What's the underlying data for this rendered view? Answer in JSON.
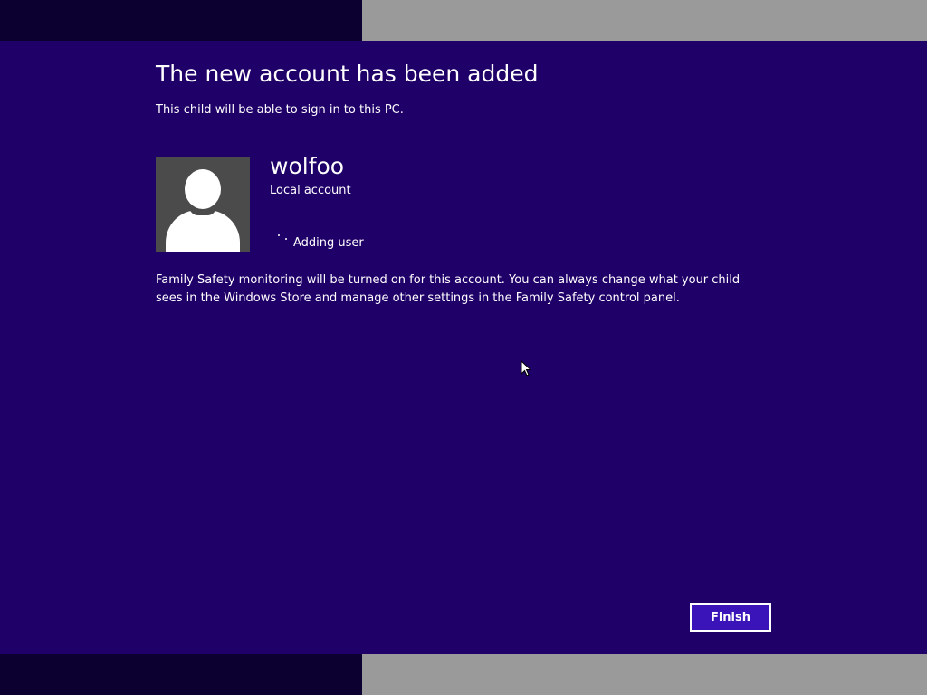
{
  "page": {
    "title": "The new account has been added",
    "subtitle": "This child will be able to sign in to this PC."
  },
  "account": {
    "name": "wolfoo",
    "type": "Local account",
    "avatar_icon": "default-user-silhouette-icon"
  },
  "status": {
    "text": "Adding user",
    "icon": "progress-dots-icon"
  },
  "info": {
    "text": "Family Safety monitoring will be turned on for this account. You can always change what your child sees in the Windows Store and manage other settings in the Family Safety control panel."
  },
  "actions": {
    "finish_label": "Finish"
  },
  "colors": {
    "background": "#1f0068",
    "bar_dark": "#0c0030",
    "bar_gray": "#9a9a9a",
    "avatar_bg": "#4b4b4b",
    "button_bg": "#3a14b8",
    "text": "#ffffff"
  }
}
